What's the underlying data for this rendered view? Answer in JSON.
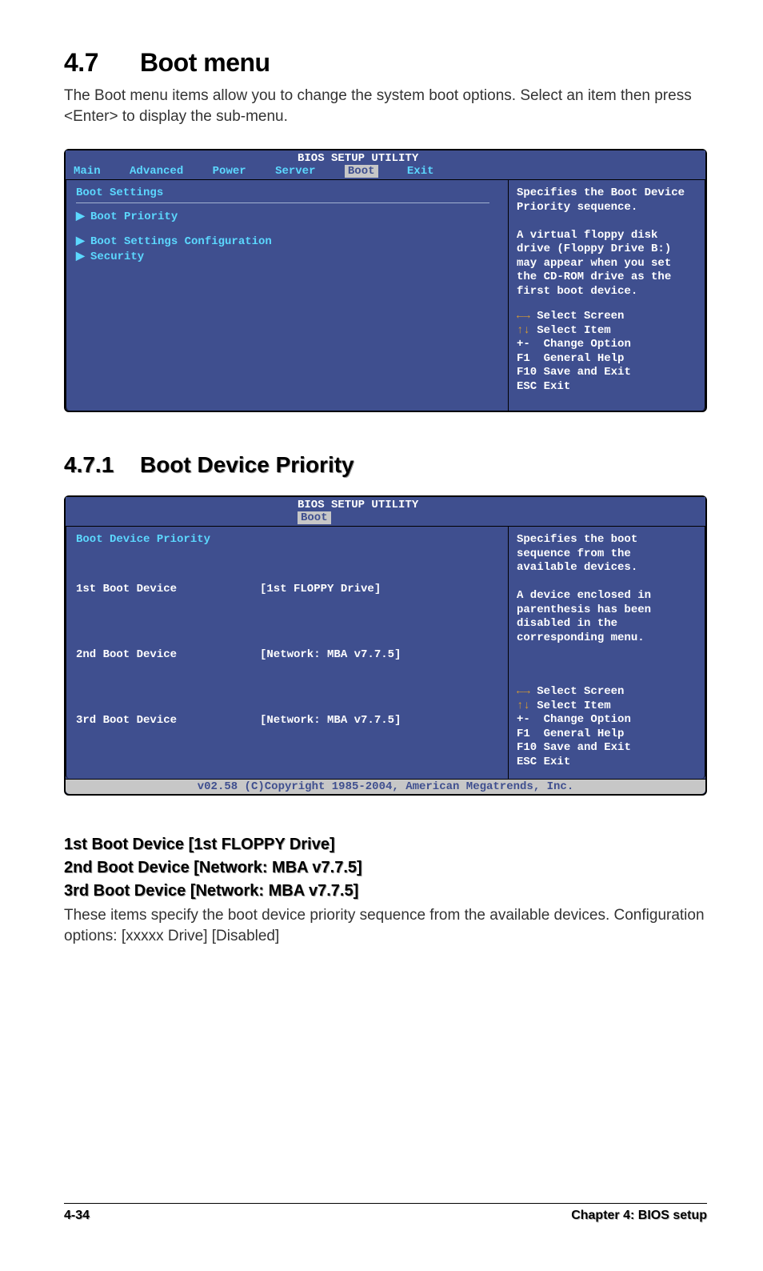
{
  "heading": {
    "num": "4.7",
    "title": "Boot menu"
  },
  "intro": "The Boot menu items allow you to change the system boot options. Select an item then press <Enter> to display the sub-menu.",
  "bios1": {
    "title": "BIOS SETUP UTILITY",
    "menus": [
      "Main",
      "Advanced",
      "Power",
      "Server",
      "Boot",
      "Exit"
    ],
    "selected_menu": "Boot",
    "left_title": "Boot Settings",
    "items": [
      {
        "label": "Boot Priority",
        "arrow": true,
        "blue": true
      },
      {
        "label": "Boot Settings Configuration",
        "arrow": true,
        "blue": true
      },
      {
        "label": "Security",
        "arrow": true,
        "blue": true
      }
    ],
    "help": "Specifies the Boot Device Priority sequence.\n\nA virtual floppy disk drive (Floppy Drive B:) may appear when you set the CD-ROM drive as the first boot device.",
    "keys": [
      {
        "sym": "←→",
        "txt": "Select Screen"
      },
      {
        "sym": "↑↓",
        "txt": "Select Item"
      },
      {
        "sym": "+-",
        "txt": "Change Option"
      },
      {
        "sym": "F1",
        "txt": "General Help"
      },
      {
        "sym": "F10",
        "txt": "Save and Exit"
      },
      {
        "sym": "ESC",
        "txt": "Exit"
      }
    ]
  },
  "sub": {
    "num": "4.7.1",
    "title": "Boot Device Priority"
  },
  "bios2": {
    "title": "BIOS SETUP UTILITY",
    "menu_single": "Boot",
    "left_title": "Boot Device Priority",
    "rows": [
      {
        "k": "1st Boot Device",
        "v": "[1st FLOPPY Drive]"
      },
      {
        "k": "2nd Boot Device",
        "v": "[Network: MBA v7.7.5]"
      },
      {
        "k": "3rd Boot Device",
        "v": "[Network: MBA v7.7.5]"
      }
    ],
    "help": "Specifies the boot sequence from the available devices.\n\nA device enclosed in parenthesis has been disabled in the corresponding menu.",
    "keys": [
      {
        "sym": "←→",
        "txt": "Select Screen"
      },
      {
        "sym": "↑↓",
        "txt": "Select Item"
      },
      {
        "sym": "+-",
        "txt": "Change Option"
      },
      {
        "sym": "F1",
        "txt": "General Help"
      },
      {
        "sym": "F10",
        "txt": "Save and Exit"
      },
      {
        "sym": "ESC",
        "txt": "Exit"
      }
    ],
    "footer": "v02.58 (C)Copyright 1985-2004, American Megatrends, Inc."
  },
  "items_headings": [
    "1st Boot Device [1st FLOPPY Drive]",
    "2nd Boot Device [Network: MBA v7.7.5]",
    "3rd Boot Device [Network: MBA v7.7.5]"
  ],
  "items_desc": "These items specify the boot device priority sequence from the available devices. Configuration options: [xxxxx Drive] [Disabled]",
  "footer": {
    "page": "4-34",
    "chapter": "Chapter 4: BIOS setup"
  }
}
